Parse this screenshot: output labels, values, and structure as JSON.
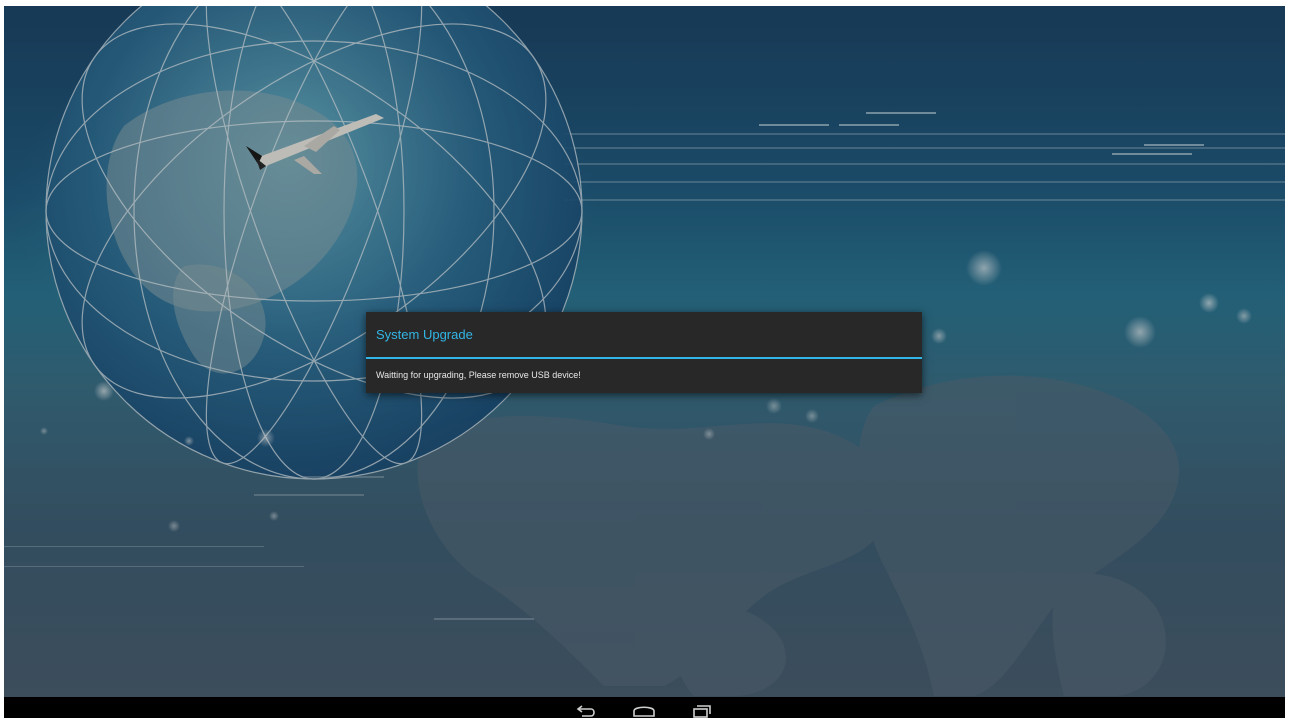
{
  "dialog": {
    "title": "System Upgrade",
    "message": "Waitting for upgrading, Please remove USB device!"
  },
  "navigation_bar": {
    "buttons": [
      {
        "name": "back",
        "icon": "back-icon"
      },
      {
        "name": "home",
        "icon": "home-icon"
      },
      {
        "name": "recent-apps",
        "icon": "recent-apps-icon"
      }
    ]
  },
  "colors": {
    "accent": "#33b5e5",
    "dialog_background": "#282828",
    "navbar_background": "#000000"
  },
  "wallpaper": {
    "description_icon": "globe-airplane-wallpaper"
  }
}
